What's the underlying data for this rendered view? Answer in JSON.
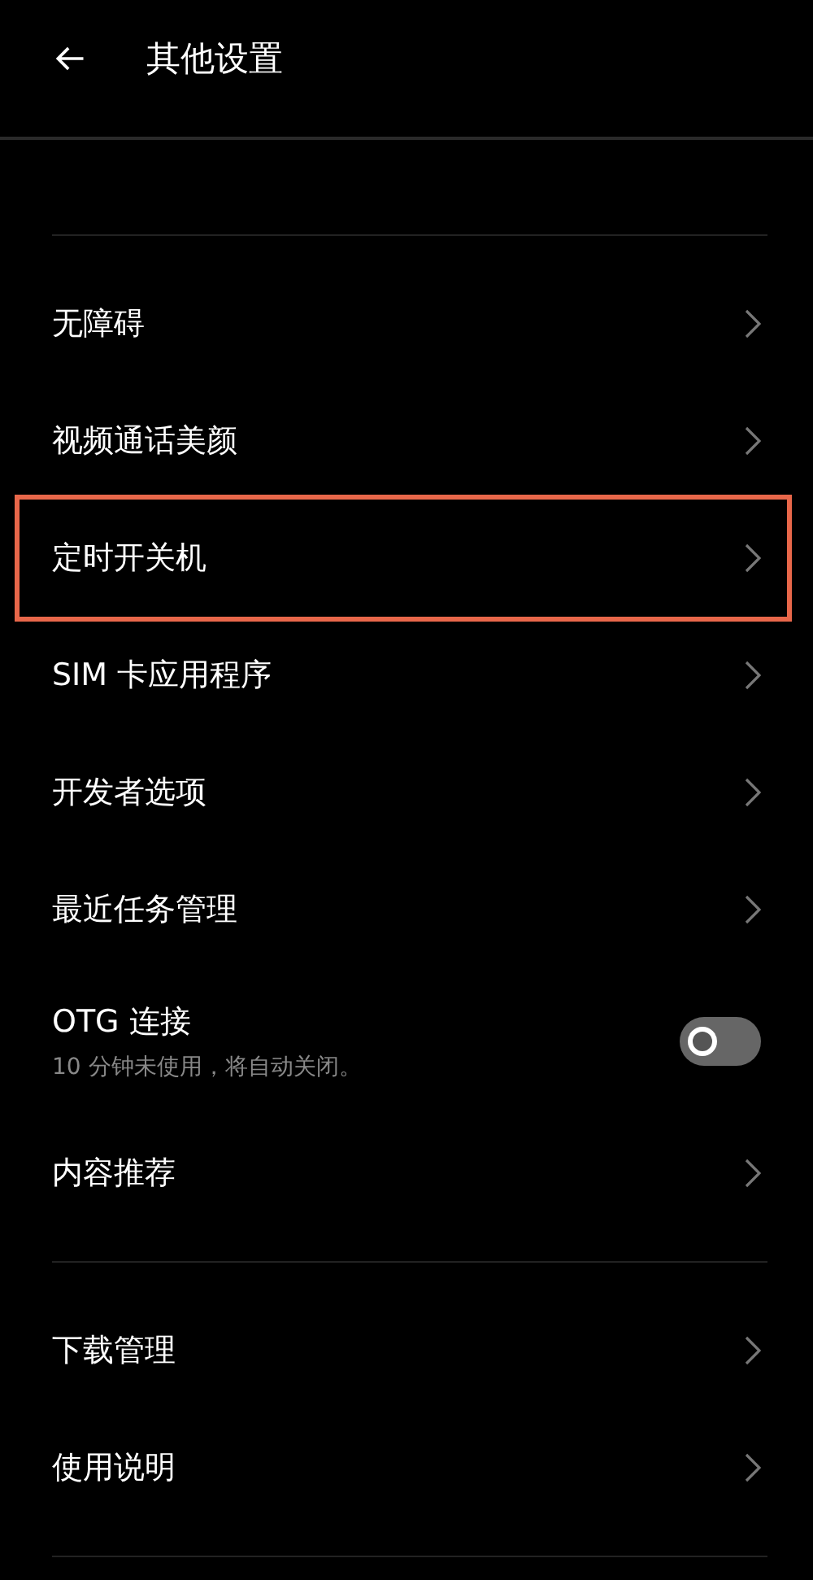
{
  "header": {
    "title": "其他设置"
  },
  "sections": [
    {
      "items": [
        {
          "kind": "link",
          "label": "无障碍",
          "highlighted": false
        },
        {
          "kind": "link",
          "label": "视频通话美颜",
          "highlighted": false
        },
        {
          "kind": "link",
          "label": "定时开关机",
          "highlighted": true
        },
        {
          "kind": "link",
          "label": "SIM 卡应用程序",
          "highlighted": false
        },
        {
          "kind": "link",
          "label": "开发者选项",
          "highlighted": false
        },
        {
          "kind": "link",
          "label": "最近任务管理",
          "highlighted": false
        },
        {
          "kind": "toggle",
          "label": "OTG 连接",
          "subtitle": "10 分钟未使用，将自动关闭。",
          "on": false,
          "highlighted": false
        },
        {
          "kind": "link",
          "label": "内容推荐",
          "highlighted": false
        }
      ]
    },
    {
      "items": [
        {
          "kind": "link",
          "label": "下载管理",
          "highlighted": false
        },
        {
          "kind": "link",
          "label": "使用说明",
          "highlighted": false
        }
      ]
    }
  ]
}
